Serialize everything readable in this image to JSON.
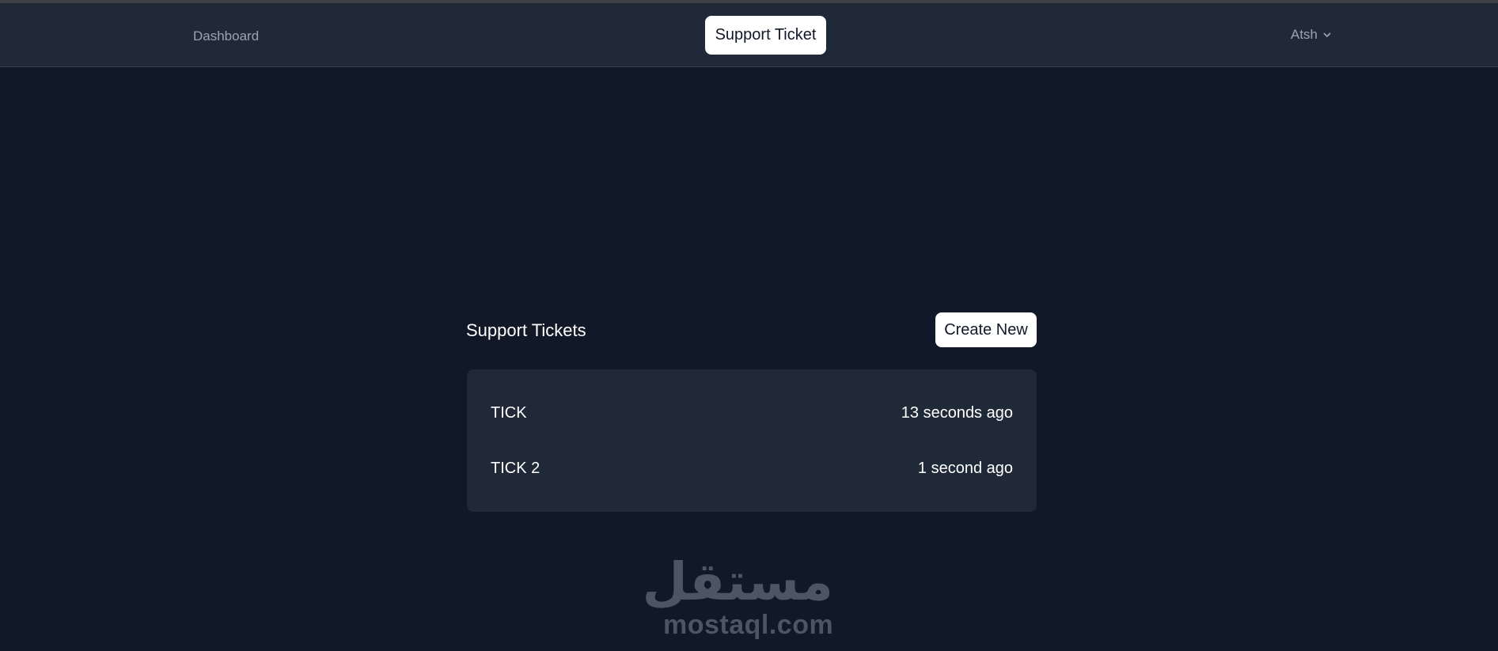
{
  "nav": {
    "dashboard_label": "Dashboard",
    "active_label": "Support Ticket",
    "user_name": "Atsh"
  },
  "main": {
    "title": "Support Tickets",
    "create_label": "Create New",
    "tickets": [
      {
        "name": "TICK",
        "time": "13 seconds ago"
      },
      {
        "name": "TICK 2",
        "time": "1 second ago"
      }
    ]
  },
  "watermark": {
    "arabic": "مستقل",
    "latin": "mostaql.com"
  },
  "colors": {
    "page_bg": "#111827",
    "nav_bg": "#1f2937",
    "card_bg": "#1f2937",
    "button_bg": "#ffffff",
    "muted_text": "#9ca3af"
  },
  "icons": {
    "user_dropdown": "chevron-down-icon"
  }
}
